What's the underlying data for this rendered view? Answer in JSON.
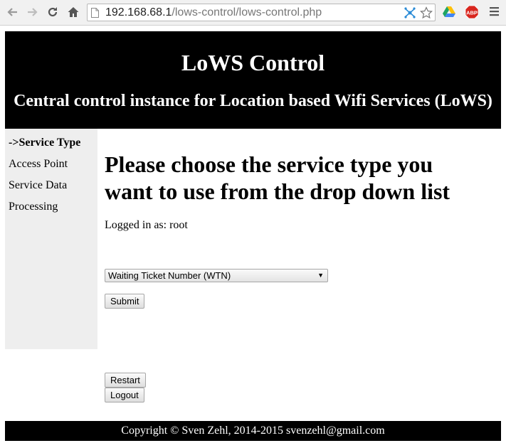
{
  "browser": {
    "url_host": "192.168.68.1",
    "url_path": "/lows-control/lows-control.php",
    "extensions": {
      "abp_label": "ABP"
    }
  },
  "header": {
    "title": "LoWS Control",
    "subtitle": "Central control instance for Location based Wifi Services (LoWS)"
  },
  "sidebar": {
    "items": [
      {
        "label": "->Service Type",
        "active": true
      },
      {
        "label": "Access Point",
        "active": false
      },
      {
        "label": "Service Data",
        "active": false
      },
      {
        "label": "Processing",
        "active": false
      }
    ]
  },
  "main": {
    "heading": "Please choose the service type you want to use from the drop down list",
    "logged_in": "Logged in as: root",
    "service_select": {
      "selected": "Waiting Ticket Number (WTN)"
    },
    "submit_label": "Submit",
    "restart_label": "Restart",
    "logout_label": "Logout"
  },
  "footer": {
    "text": "Copyright © Sven Zehl, 2014-2015 svenzehl@gmail.com"
  },
  "colors": {
    "header_bg": "#000000",
    "sidebar_bg": "#eeeeee",
    "abp_red": "#d8261e",
    "drive_green": "#1fa463"
  }
}
